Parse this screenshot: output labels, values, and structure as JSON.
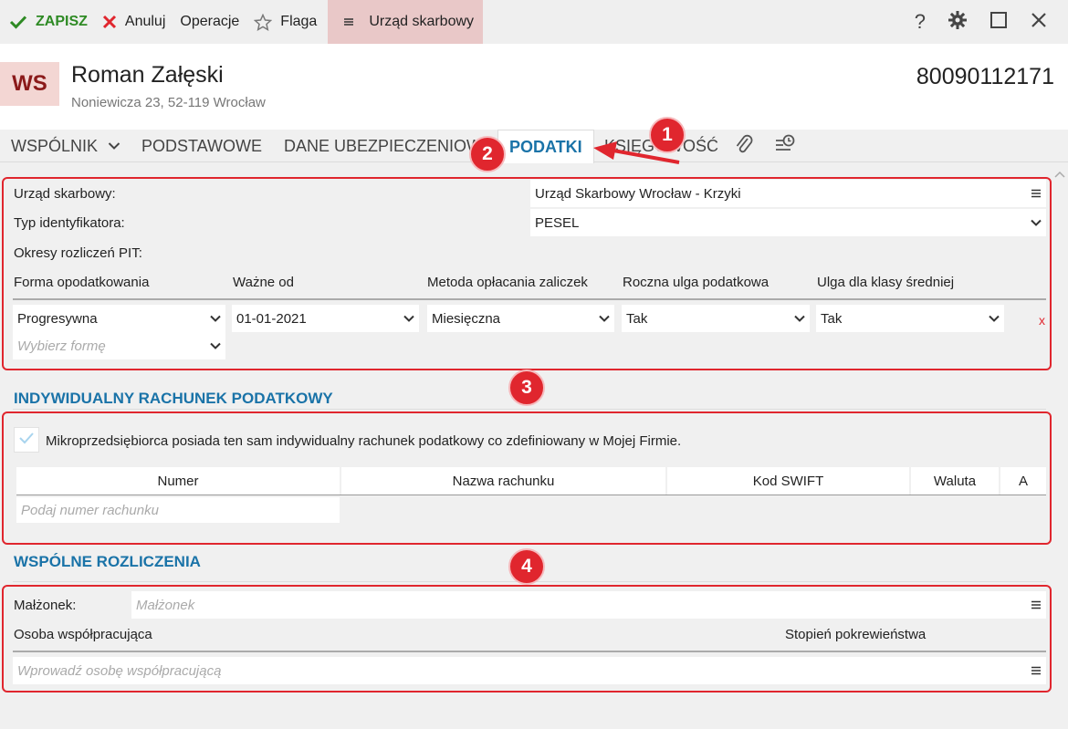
{
  "toolbar": {
    "save": "ZAPISZ",
    "cancel": "Anuluj",
    "operations": "Operacje",
    "flag": "Flaga",
    "tax_office": "Urząd skarbowy",
    "help": "?"
  },
  "header": {
    "initials": "WS",
    "name": "Roman Załęski",
    "address": "Noniewicza 23, 52-119 Wrocław",
    "id_number": "80090112171"
  },
  "tabs": {
    "partner": "WSPÓLNIK",
    "basic": "PODSTAWOWE",
    "insurance": "DANE UBEZPIECZENIOWE",
    "taxes": "PODATKI",
    "accounting": "KSIĘGOWOŚĆ"
  },
  "badges": [
    "1",
    "2",
    "3",
    "4"
  ],
  "taxes": {
    "office_label": "Urząd skarbowy:",
    "office_value": "Urząd Skarbowy Wrocław - Krzyki",
    "id_type_label": "Typ identyfikatora:",
    "id_type_value": "PESEL",
    "pit_periods_label": "Okresy rozliczeń PIT:",
    "columns": [
      "Forma opodatkowania",
      "Ważne od",
      "Metoda opłacania zaliczek",
      "Roczna ulga podatkowa",
      "Ulga dla klasy średniej"
    ],
    "row": {
      "form": "Progresywna",
      "valid_from": "01-01-2021",
      "method": "Miesięczna",
      "annual_relief": "Tak",
      "middle_class_relief": "Tak",
      "delete": "x"
    },
    "new_form_placeholder": "Wybierz formę"
  },
  "account": {
    "title": "INDYWIDUALNY RACHUNEK PODATKOWY",
    "checkbox_label": "Mikroprzedsiębiorca posiada ten sam indywidualny rachunek podatkowy co zdefiniowany w Mojej Firmie.",
    "checkbox_checked": true,
    "columns": [
      "Numer",
      "Nazwa rachunku",
      "Kod SWIFT",
      "Waluta",
      "A"
    ],
    "number_placeholder": "Podaj numer rachunku"
  },
  "joint": {
    "title": "WSPÓLNE ROZLICZENIA",
    "spouse_label": "Małżonek:",
    "spouse_placeholder": "Małżonek",
    "cooperating_label": "Osoba współpracująca",
    "kinship_label": "Stopień pokrewieństwa",
    "cooperating_placeholder": "Wprowadź osobę współpracującą"
  },
  "colors": {
    "accent": "#1a73a8",
    "annotation_red": "#e0262e",
    "save_green": "#2e8a24",
    "avatar_bg": "#f3d6d3",
    "avatar_text": "#8b1a1a"
  }
}
